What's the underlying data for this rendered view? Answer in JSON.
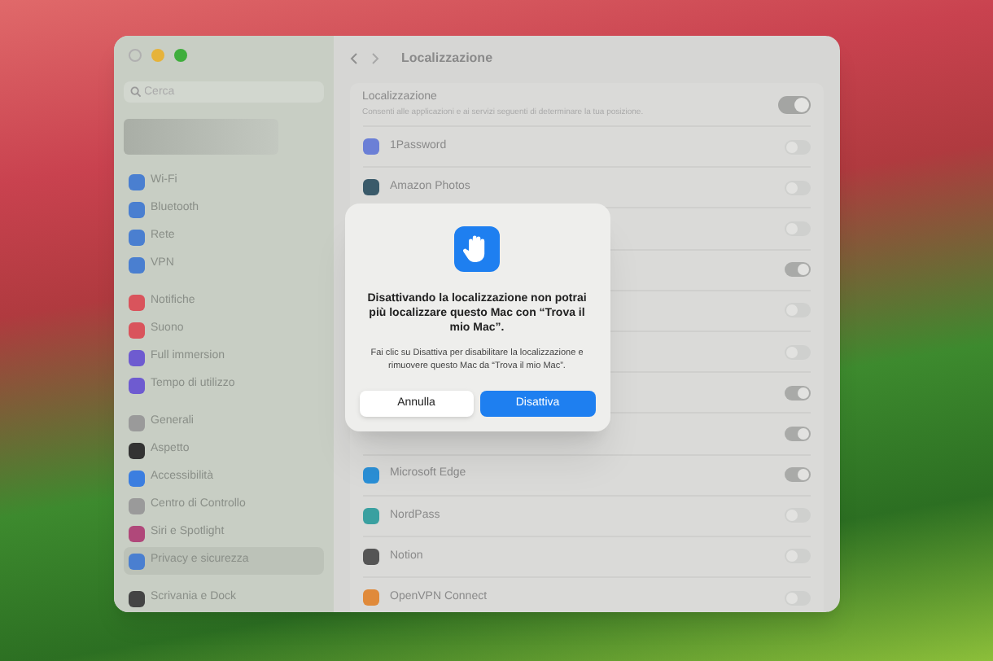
{
  "window": {
    "title": "Localizzazione"
  },
  "sidebar": {
    "search": {
      "placeholder": "Cerca"
    },
    "groups": [
      [
        {
          "label": "Wi-Fi",
          "color": "#4a7fd0",
          "selected": false
        },
        {
          "label": "Bluetooth",
          "color": "#4a7fd0",
          "selected": false
        },
        {
          "label": "Rete",
          "color": "#4a7fd0",
          "selected": false
        },
        {
          "label": "VPN",
          "color": "#4a7fd0",
          "selected": false
        }
      ],
      [
        {
          "label": "Notifiche",
          "color": "#d9545c",
          "selected": false
        },
        {
          "label": "Suono",
          "color": "#d9545c",
          "selected": false
        },
        {
          "label": "Full immersion",
          "color": "#6e5bd0",
          "selected": false
        },
        {
          "label": "Tempo di utilizzo",
          "color": "#6e5bd0",
          "selected": false
        }
      ],
      [
        {
          "label": "Generali",
          "color": "#9a9a9a",
          "selected": false
        },
        {
          "label": "Aspetto",
          "color": "#333333",
          "selected": false
        },
        {
          "label": "Accessibilità",
          "color": "#3b7ee0",
          "selected": false
        },
        {
          "label": "Centro di Controllo",
          "color": "#9a9a9a",
          "selected": false
        },
        {
          "label": "Siri e Spotlight",
          "color": "#b0487a",
          "selected": false
        },
        {
          "label": "Privacy e sicurezza",
          "color": "#4a7fd0",
          "selected": true
        }
      ],
      [
        {
          "label": "Scrivania e Dock",
          "color": "#444444",
          "selected": false
        }
      ]
    ]
  },
  "location": {
    "title": "Localizzazione",
    "description": "Consenti alle applicazioni e ai servizi seguenti di determinare la tua posizione.",
    "on": true
  },
  "apps": [
    {
      "name": "1Password",
      "color": "#6b7fd6",
      "on": false
    },
    {
      "name": "Amazon Photos",
      "color": "#3a5a6a",
      "on": false
    },
    {
      "on": false
    },
    {
      "on": true
    },
    {
      "on": false
    },
    {
      "on": false
    },
    {
      "on": true
    },
    {
      "on": true
    },
    {
      "name": "Microsoft Edge",
      "color": "#2a8fd6",
      "on": true
    },
    {
      "name": "NordPass",
      "color": "#3aa0a0",
      "on": false
    },
    {
      "name": "Notion",
      "color": "#555555",
      "on": false
    },
    {
      "name": "OpenVPN Connect",
      "color": "#e08a3a",
      "on": false
    }
  ],
  "dialog": {
    "title": "Disattivando la localizzazione non potrai più localizzare questo Mac con “Trova il mio Mac”.",
    "message": "Fai clic su Disattiva per disabilitare la localizzazione e rimuovere questo Mac da “Trova il mio Mac”.",
    "buttons": [
      {
        "label": "Annulla",
        "kind": "secondary"
      },
      {
        "label": "Disattiva",
        "kind": "primary"
      }
    ]
  }
}
